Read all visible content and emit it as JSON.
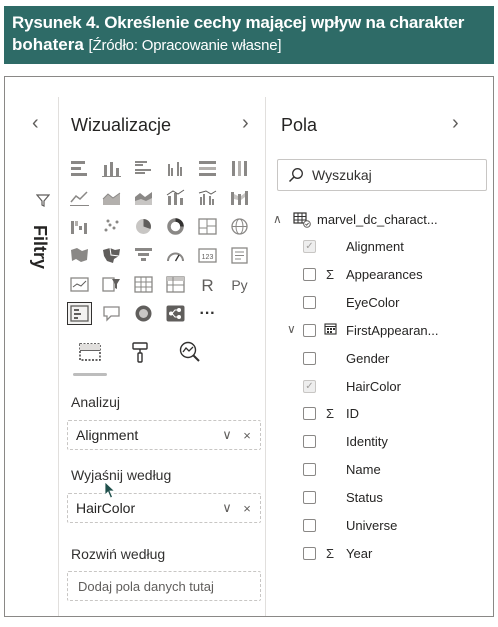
{
  "caption": {
    "prefix": "Rysunek 4. Określenie cechy mającej wpływ na charakter",
    "line2_bold": "bohatera",
    "source": "[Źródło: Opracowanie własne]"
  },
  "filters": {
    "collapse_glyph": "‹",
    "label": "Filtry",
    "icon": "filter-icon"
  },
  "visualizations": {
    "title": "Wizualizacje",
    "expand_glyph": "›",
    "more_glyph": "···",
    "r_glyph": "R",
    "py_glyph": "Py",
    "tabs": [
      "build-visual-icon",
      "format-visual-icon",
      "analytics-icon"
    ],
    "wells": {
      "analyze_label": "Analizuj",
      "analyze_value": "Alignment",
      "explain_label": "Wyjaśnij według",
      "explain_value": "HairColor",
      "expand_label": "Rozwiń według",
      "expand_placeholder": "Dodaj pola danych tutaj"
    },
    "remove_glyph": "×",
    "dropdown_glyph": "∨"
  },
  "fields": {
    "title": "Pola",
    "expand_glyph": "›",
    "search_placeholder": "Wyszukaj",
    "table_name": "marvel_dc_charact...",
    "items": [
      {
        "name": "Alignment",
        "checked": true,
        "sym": ""
      },
      {
        "name": "Appearances",
        "checked": false,
        "sym": "Σ"
      },
      {
        "name": "EyeColor",
        "checked": false,
        "sym": ""
      },
      {
        "name": "FirstAppearan...",
        "checked": false,
        "sym": "cal"
      },
      {
        "name": "Gender",
        "checked": false,
        "sym": ""
      },
      {
        "name": "HairColor",
        "checked": true,
        "sym": ""
      },
      {
        "name": "ID",
        "checked": false,
        "sym": "Σ"
      },
      {
        "name": "Identity",
        "checked": false,
        "sym": ""
      },
      {
        "name": "Name",
        "checked": false,
        "sym": ""
      },
      {
        "name": "Status",
        "checked": false,
        "sym": ""
      },
      {
        "name": "Universe",
        "checked": false,
        "sym": ""
      },
      {
        "name": "Year",
        "checked": false,
        "sym": "Σ"
      }
    ]
  }
}
